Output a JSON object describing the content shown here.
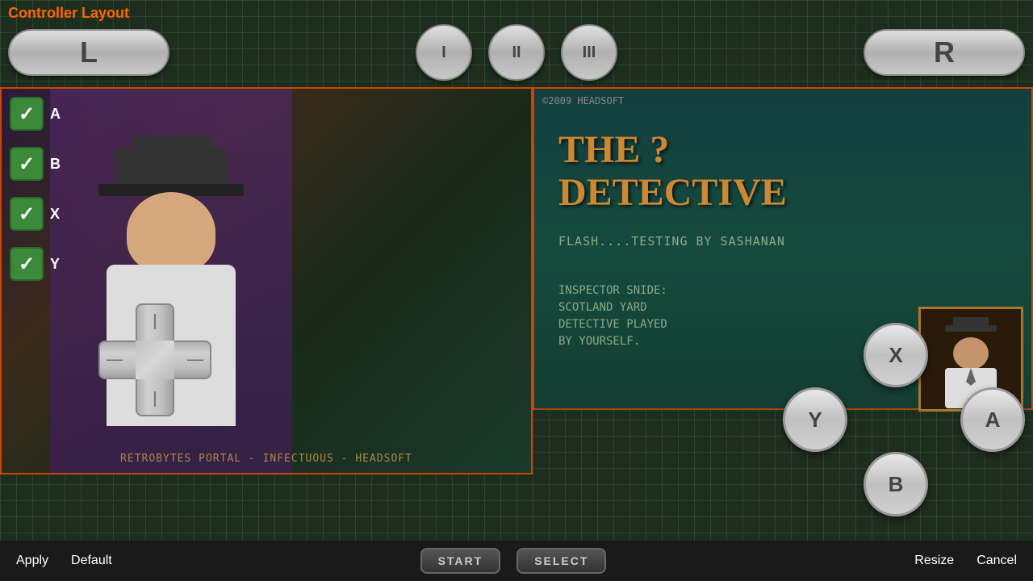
{
  "title": "Controller Layout",
  "topButtons": {
    "L": "L",
    "I": "I",
    "II": "II",
    "III": "III",
    "R": "R"
  },
  "buttonLabels": [
    {
      "id": "A",
      "label": "A",
      "checked": true
    },
    {
      "id": "B",
      "label": "B",
      "checked": true
    },
    {
      "id": "X",
      "label": "X",
      "checked": true
    },
    {
      "id": "Y",
      "label": "Y",
      "checked": true
    }
  ],
  "gameBottom": "RETROBYTES PORTAL - INFECTUOUS - HEADSOFT",
  "rightPanel": {
    "copyright": "©2009 HEADSOFT",
    "title": "THE ?\nDETECTIVE",
    "flashText": "FLASH....TESTING BY SASHANAN",
    "inspectorTitle": "INSPECTOR SNIDE:",
    "inspectorText": "SCOTLAND YARD\nDETECTIVE PLAYED\nBY YOURSELF."
  },
  "actionButtons": {
    "X": "X",
    "Y": "Y",
    "A": "A",
    "B": "B"
  },
  "bottomBar": {
    "apply": "Apply",
    "default": "Default",
    "start": "START",
    "select": "SELECT",
    "resize": "Resize",
    "cancel": "Cancel"
  }
}
